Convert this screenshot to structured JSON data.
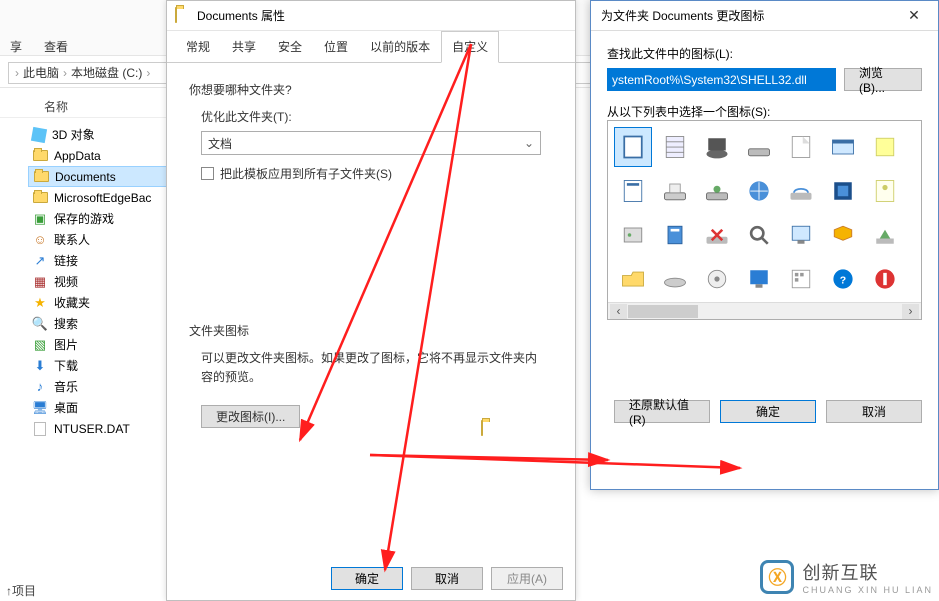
{
  "explorer": {
    "menu": {
      "share": "享",
      "view": "查看"
    },
    "crumbs": {
      "pc": "此电脑",
      "drive": "本地磁盘 (C:)"
    },
    "col_header": "名称",
    "tree": [
      {
        "icon": "3d",
        "label": "3D 对象"
      },
      {
        "icon": "folder",
        "label": "AppData"
      },
      {
        "icon": "folder",
        "label": "Documents",
        "selected": true
      },
      {
        "icon": "folder",
        "label": "MicrosoftEdgeBac"
      },
      {
        "icon": "game",
        "label": "保存的游戏"
      },
      {
        "icon": "contact",
        "label": "联系人"
      },
      {
        "icon": "link",
        "label": "链接"
      },
      {
        "icon": "video",
        "label": "视频"
      },
      {
        "icon": "star",
        "label": "收藏夹"
      },
      {
        "icon": "search",
        "label": "搜索"
      },
      {
        "icon": "pic",
        "label": "图片"
      },
      {
        "icon": "download",
        "label": "下载"
      },
      {
        "icon": "music",
        "label": "音乐"
      },
      {
        "icon": "desktop",
        "label": "桌面"
      },
      {
        "icon": "file",
        "label": "NTUSER.DAT"
      }
    ],
    "footer": "↑项目"
  },
  "props": {
    "title": "Documents 属性",
    "tabs": {
      "general": "常规",
      "share": "共享",
      "security": "安全",
      "location": "位置",
      "prev": "以前的版本",
      "custom": "自定义"
    },
    "q1": "你想要哪种文件夹?",
    "opt_label": "优化此文件夹(T):",
    "combo_value": "文档",
    "chk_label": "把此模板应用到所有子文件夹(S)",
    "sec_title": "文件夹图标",
    "desc": "可以更改文件夹图标。如果更改了图标，它将不再显示文件夹内容的预览。",
    "change_btn": "更改图标(I)...",
    "ok": "确定",
    "cancel": "取消",
    "apply": "应用(A)"
  },
  "icondlg": {
    "title": "为文件夹 Documents 更改图标",
    "find_label": "查找此文件中的图标(L):",
    "path": "ystemRoot%\\System32\\SHELL32.dll",
    "browse": "浏览(B)...",
    "select_label": "从以下列表中选择一个图标(S):",
    "restore": "还原默认值(R)",
    "ok": "确定",
    "cancel": "取消"
  },
  "watermark": {
    "brand": "创新互联",
    "sub": "CHUANG XIN HU LIAN"
  }
}
